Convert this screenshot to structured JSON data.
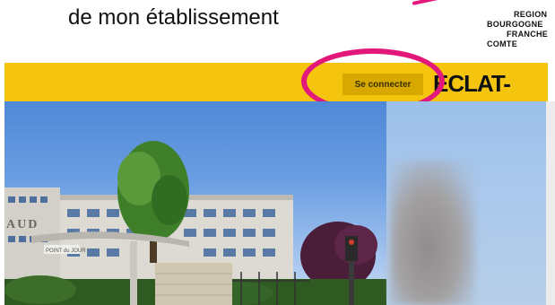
{
  "caption": "de mon établissement",
  "region_logo": {
    "lines": [
      "REGION",
      "BOURGOGNE",
      "FRANCHE",
      "COMTE"
    ],
    "color": "#e2197a"
  },
  "header": {
    "background": "#f4c40f",
    "login_button": "Se connecter",
    "logo_text": "ECLAT-BFC"
  },
  "photo": {
    "sign_text": "AUD",
    "sign_text_small": "POINT du JOUR"
  }
}
